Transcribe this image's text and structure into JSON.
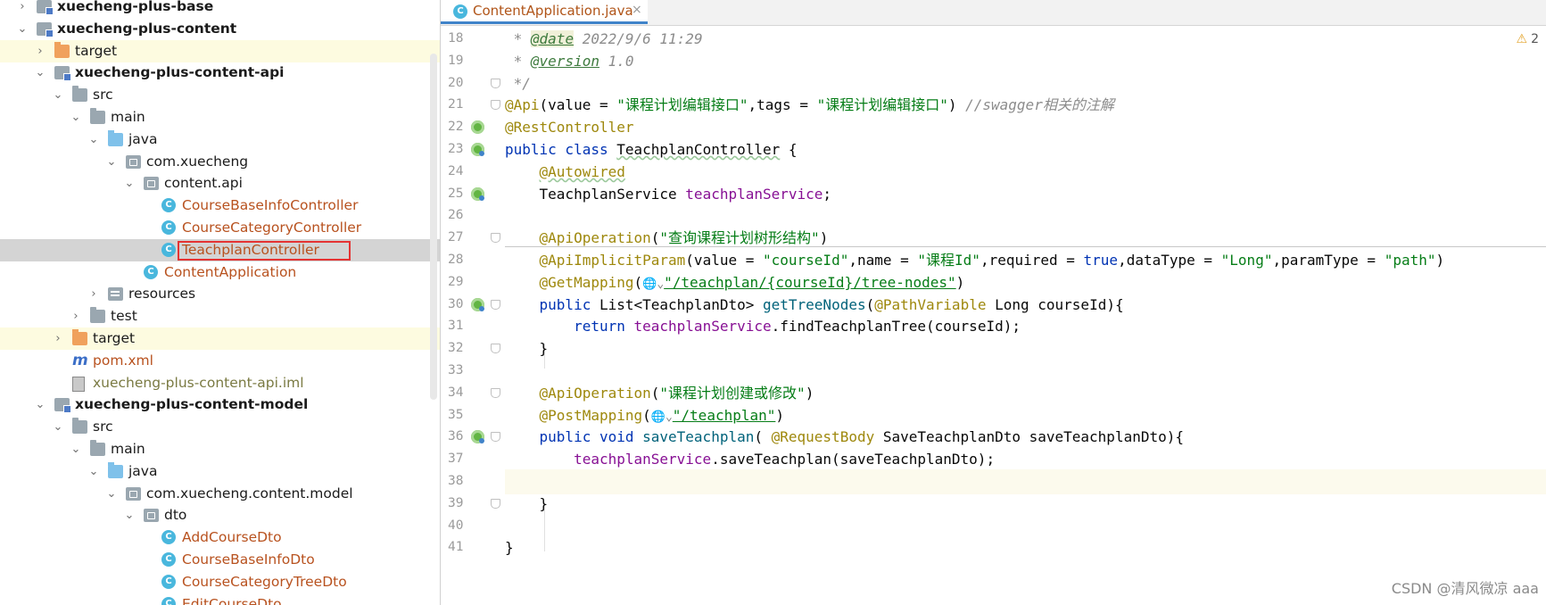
{
  "project_tree": {
    "rows": [
      {
        "label": "xuecheng-plus-base",
        "chevron": "›",
        "icon": "module-icon",
        "bold": true
      },
      {
        "label": "xuecheng-plus-content",
        "chevron": "⌄",
        "icon": "module-icon",
        "bold": true
      },
      {
        "label": "target",
        "chevron": "›",
        "icon": "folder-orange-icon",
        "excluded": true
      },
      {
        "label": "xuecheng-plus-content-api",
        "chevron": "⌄",
        "icon": "module-icon",
        "bold": true
      },
      {
        "label": "src",
        "chevron": "⌄",
        "icon": "folder-icon"
      },
      {
        "label": "main",
        "chevron": "⌄",
        "icon": "folder-icon"
      },
      {
        "label": "java",
        "chevron": "⌄",
        "icon": "source-folder-icon"
      },
      {
        "label": "com.xuecheng",
        "chevron": "⌄",
        "icon": "package-icon"
      },
      {
        "label": "content.api",
        "chevron": "⌄",
        "icon": "package-icon"
      },
      {
        "label": "CourseBaseInfoController",
        "icon": "class-icon",
        "orange": true
      },
      {
        "label": "CourseCategoryController",
        "icon": "class-icon",
        "orange": true
      },
      {
        "label": "TeachplanController",
        "icon": "class-icon",
        "orange": true,
        "selected": true
      },
      {
        "label": "ContentApplication",
        "icon": "class-icon",
        "orange": true
      },
      {
        "label": "resources",
        "chevron": "›",
        "icon": "resources-folder-icon"
      },
      {
        "label": "test",
        "chevron": "›",
        "icon": "folder-icon"
      },
      {
        "label": "target",
        "chevron": "›",
        "icon": "folder-orange-icon",
        "excluded": true
      },
      {
        "label": "pom.xml",
        "icon": "maven-icon",
        "orange": true
      },
      {
        "label": "xuecheng-plus-content-api.iml",
        "icon": "iml-file-icon",
        "olive": true
      },
      {
        "label": "xuecheng-plus-content-model",
        "chevron": "⌄",
        "icon": "module-icon",
        "bold": true
      },
      {
        "label": "src",
        "chevron": "⌄",
        "icon": "folder-icon"
      },
      {
        "label": "main",
        "chevron": "⌄",
        "icon": "folder-icon"
      },
      {
        "label": "java",
        "chevron": "⌄",
        "icon": "source-folder-icon"
      },
      {
        "label": "com.xuecheng.content.model",
        "chevron": "⌄",
        "icon": "package-icon"
      },
      {
        "label": "dto",
        "chevron": "⌄",
        "icon": "package-icon"
      },
      {
        "label": "AddCourseDto",
        "icon": "class-icon",
        "orange": true
      },
      {
        "label": "CourseBaseInfoDto",
        "icon": "class-icon",
        "orange": true
      },
      {
        "label": "CourseCategoryTreeDto",
        "icon": "class-icon",
        "orange": true
      },
      {
        "label": "EditCourseDto",
        "icon": "class-icon",
        "orange": true
      }
    ]
  },
  "editor": {
    "tab": {
      "label": "ContentApplication.java",
      "close": "×",
      "icon_letter": "C"
    },
    "warnings": {
      "icon": "⚠",
      "count": "2"
    },
    "lines": [
      {
        "n": "18"
      },
      {
        "n": "19"
      },
      {
        "n": "20"
      },
      {
        "n": "21"
      },
      {
        "n": "22"
      },
      {
        "n": "23"
      },
      {
        "n": "24"
      },
      {
        "n": "25"
      },
      {
        "n": "26"
      },
      {
        "n": "27"
      },
      {
        "n": "28"
      },
      {
        "n": "29"
      },
      {
        "n": "30"
      },
      {
        "n": "31"
      },
      {
        "n": "32"
      },
      {
        "n": "33"
      },
      {
        "n": "34"
      },
      {
        "n": "35"
      },
      {
        "n": "36"
      },
      {
        "n": "37"
      },
      {
        "n": "38"
      },
      {
        "n": "39"
      },
      {
        "n": "40"
      },
      {
        "n": "41"
      }
    ],
    "code": {
      "l18": {
        "a": " * ",
        "b": "@date",
        "c": " 2022/9/6 11:29"
      },
      "l19": {
        "a": " * ",
        "b": "@version",
        "c": " 1.0"
      },
      "l20": {
        "a": " */"
      },
      "l21": {
        "a": "@Api",
        "b": "(value = ",
        "c": "\"课程计划编辑接口\"",
        "d": ",tags = ",
        "e": "\"课程计划编辑接口\"",
        "f": ") ",
        "g": "//swagger相关的注解"
      },
      "l22": {
        "a": "@RestController"
      },
      "l23": {
        "a": "public class ",
        "b": "TeachplanController",
        "c": " {"
      },
      "l24": {
        "a": "    ",
        "b": "@Autowired"
      },
      "l25": {
        "a": "    TeachplanService ",
        "b": "teachplanService",
        "c": ";"
      },
      "l27": {
        "a": "    ",
        "b": "@ApiOperation",
        "c": "(",
        "d": "\"查询课程计划树形结构\"",
        "e": ")"
      },
      "l28": {
        "a": "    ",
        "b": "@ApiImplicitParam",
        "c": "(value = ",
        "d": "\"courseId\"",
        "e": ",name = ",
        "f": "\"课程Id\"",
        "g": ",required = ",
        "h": "true",
        "i": ",dataType = ",
        "j": "\"Long\"",
        "k": ",paramType = ",
        "l": "\"path\"",
        "m": ")"
      },
      "l29": {
        "a": "    ",
        "b": "@GetMapping",
        "c": "(",
        "globe": "🌐⌄",
        "d": "\"/teachplan/{courseId}/tree-nodes\"",
        "e": ")"
      },
      "l30": {
        "a": "    ",
        "b": "public ",
        "c": "List<TeachplanDto> ",
        "d": "getTreeNodes",
        "e": "(",
        "f": "@PathVariable",
        "g": " Long courseId){"
      },
      "l31": {
        "a": "        ",
        "b": "return ",
        "c": "teachplanService",
        "d": ".findTeachplanTree(courseId);"
      },
      "l32": {
        "a": "    }"
      },
      "l34": {
        "a": "    ",
        "b": "@ApiOperation",
        "c": "(",
        "d": "\"课程计划创建或修改\"",
        "e": ")"
      },
      "l35": {
        "a": "    ",
        "b": "@PostMapping",
        "c": "(",
        "globe": "🌐⌄",
        "d": "\"/teachplan\"",
        "e": ")"
      },
      "l36": {
        "a": "    ",
        "b": "public void ",
        "c": "saveTeachplan",
        "d": "( ",
        "e": "@RequestBody",
        "f": " SaveTeachplanDto saveTeachplanDto){"
      },
      "l37": {
        "a": "        ",
        "b": "teachplanService",
        "c": ".saveTeachplan(saveTeachplanDto);"
      },
      "l39": {
        "a": "    }"
      },
      "l41": {
        "a": "}"
      }
    }
  },
  "watermark": "CSDN @清风微凉 aaa",
  "colors": {
    "keyword": "#0033b3",
    "string": "#067d17",
    "annotation": "#9e880d",
    "field": "#871094",
    "method": "#00627a",
    "comment": "#8c8c8c",
    "selection_box": "#e53333"
  }
}
